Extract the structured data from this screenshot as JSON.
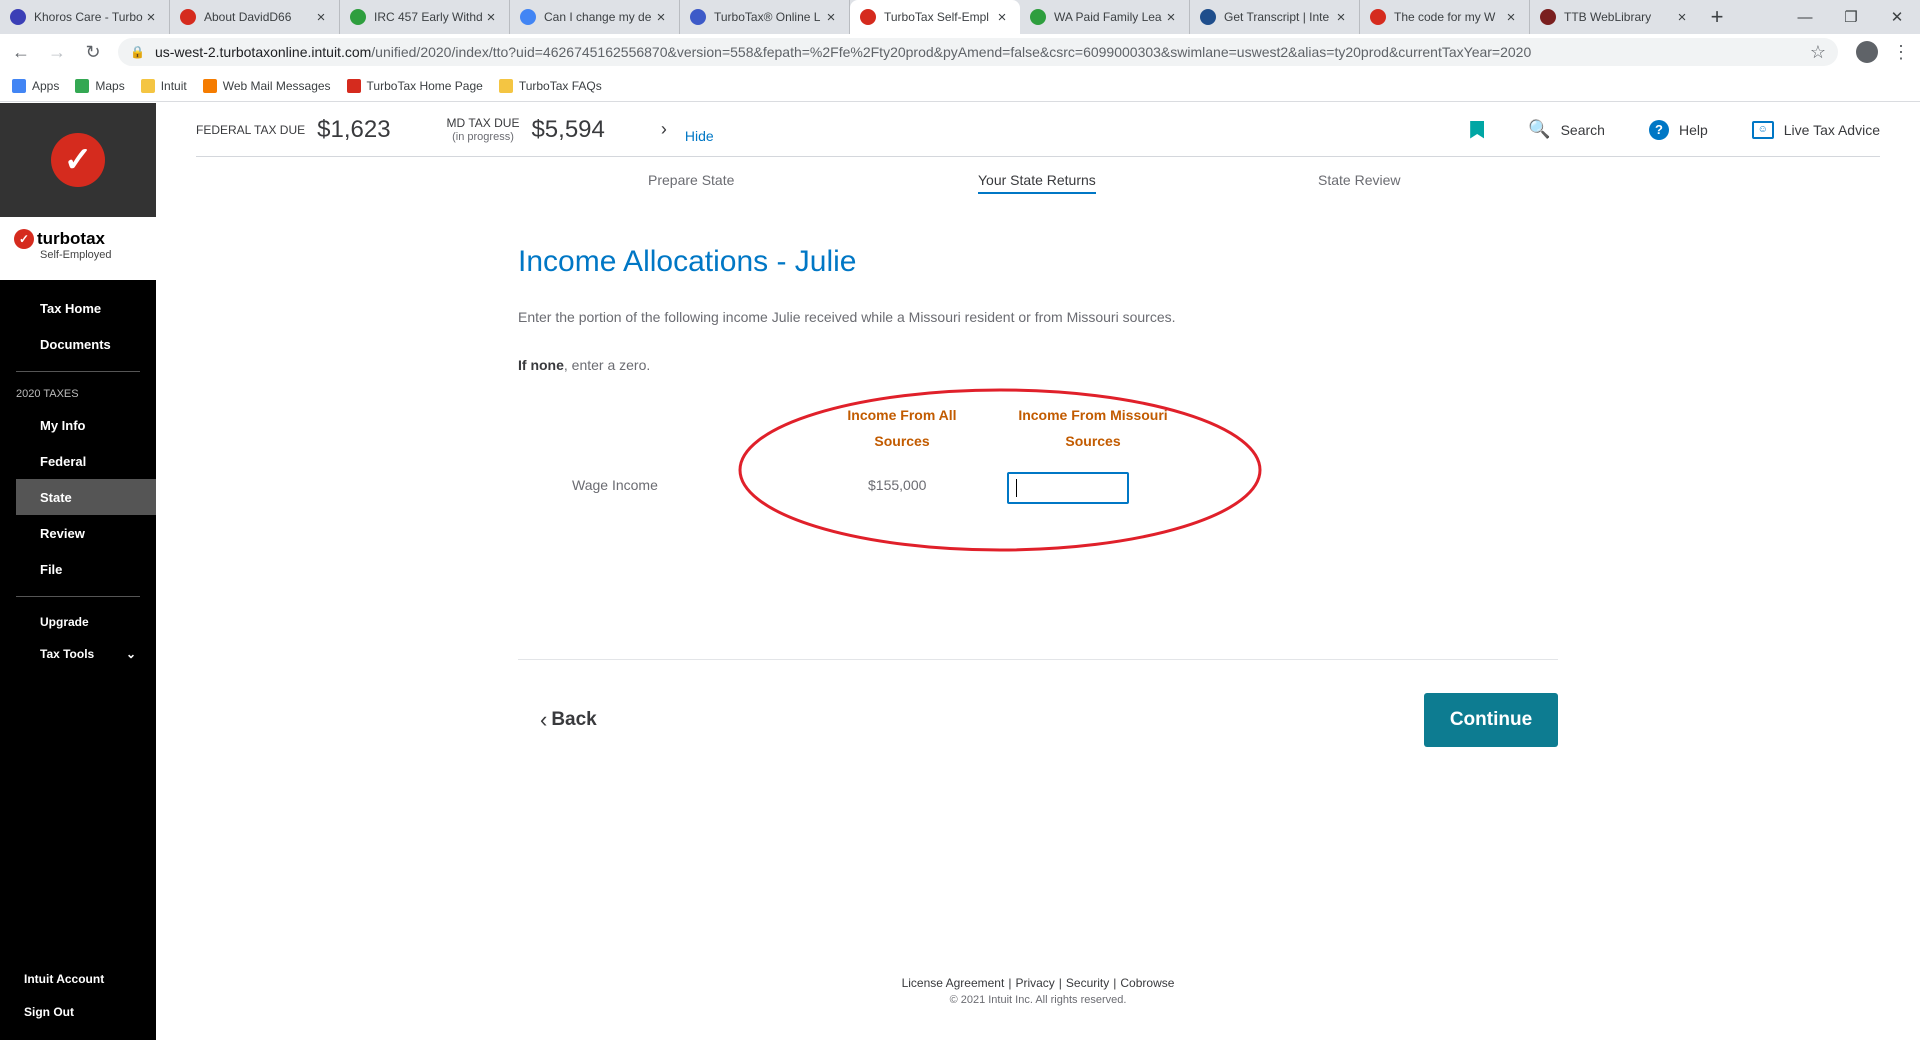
{
  "browser": {
    "tabs": [
      {
        "label": "Khoros Care - Turbo",
        "color": "#3b3fb6"
      },
      {
        "label": "About DavidD66",
        "color": "#d52b1e"
      },
      {
        "label": "IRC 457 Early Withd",
        "color": "#2e9e3e"
      },
      {
        "label": "Can I change my de",
        "color": "#4285f4"
      },
      {
        "label": "TurboTax® Online L",
        "color": "#3d5ac8"
      },
      {
        "label": "TurboTax Self-Empl",
        "color": "#d52b1e"
      },
      {
        "label": "WA Paid Family Lea",
        "color": "#2e9e3e"
      },
      {
        "label": "Get Transcript | Inte",
        "color": "#1f4e8c"
      },
      {
        "label": "The code for my W",
        "color": "#d52b1e"
      },
      {
        "label": "TTB WebLibrary",
        "color": "#7a1f1f"
      }
    ],
    "active_tab_index": 5,
    "url_host": "us-west-2.turbotaxonline.intuit.com",
    "url_path": "/unified/2020/index/tto?uid=4626745162556870&version=558&fepath=%2Ffe%2Fty20prod&pyAmend=false&csrc=6099000303&swimlane=uswest2&alias=ty20prod&currentTaxYear=2020",
    "bookmarks": [
      {
        "label": "Apps",
        "color": "#4285f4"
      },
      {
        "label": "Maps",
        "color": "#34a853"
      },
      {
        "label": "Intuit",
        "color": "#f4c542"
      },
      {
        "label": "Web Mail Messages",
        "color": "#f57c00"
      },
      {
        "label": "TurboTax Home Page",
        "color": "#d52b1e"
      },
      {
        "label": "TurboTax FAQs",
        "color": "#f4c542"
      }
    ]
  },
  "sidebar": {
    "brand_name": "turbotax",
    "brand_sub": "Self-Employed",
    "items_top": [
      "Tax Home",
      "Documents"
    ],
    "section_label": "2020 TAXES",
    "items_taxes": [
      "My Info",
      "Federal",
      "State",
      "Review",
      "File"
    ],
    "active_item": "State",
    "items_tools": [
      "Upgrade",
      "Tax Tools"
    ],
    "items_bottom": [
      "Intuit Account",
      "Sign Out"
    ]
  },
  "header": {
    "federal_label": "FEDERAL TAX DUE",
    "federal_amount": "$1,623",
    "state_label": "MD TAX DUE",
    "state_sub": "(in progress)",
    "state_amount": "$5,594",
    "hide_label": "Hide",
    "search_label": "Search",
    "help_label": "Help",
    "live_label": "Live Tax Advice"
  },
  "steps": [
    "Prepare State",
    "Your State Returns",
    "State Review"
  ],
  "active_step": "Your State Returns",
  "main": {
    "title": "Income Allocations - Julie",
    "intro": "Enter the portion of the following income Julie received while a Missouri resident or from Missouri sources.",
    "if_none_bold": "If none",
    "if_none_rest": ", enter a zero.",
    "col_all": "Income From All Sources",
    "col_missouri": "Income From Missouri Sources",
    "row_label": "Wage Income",
    "row_all_value": "$155,000",
    "row_missouri_value": "",
    "back_label": "Back",
    "continue_label": "Continue"
  },
  "footer": {
    "links": [
      "License Agreement",
      "Privacy",
      "Security",
      "Cobrowse"
    ],
    "copyright": "© 2021 Intuit Inc. All rights reserved."
  },
  "colors": {
    "accent_blue": "#0077c5",
    "continue_teal": "#0d7c91",
    "column_header_orange": "#c25b00",
    "annotation_red": "#e0202a"
  }
}
